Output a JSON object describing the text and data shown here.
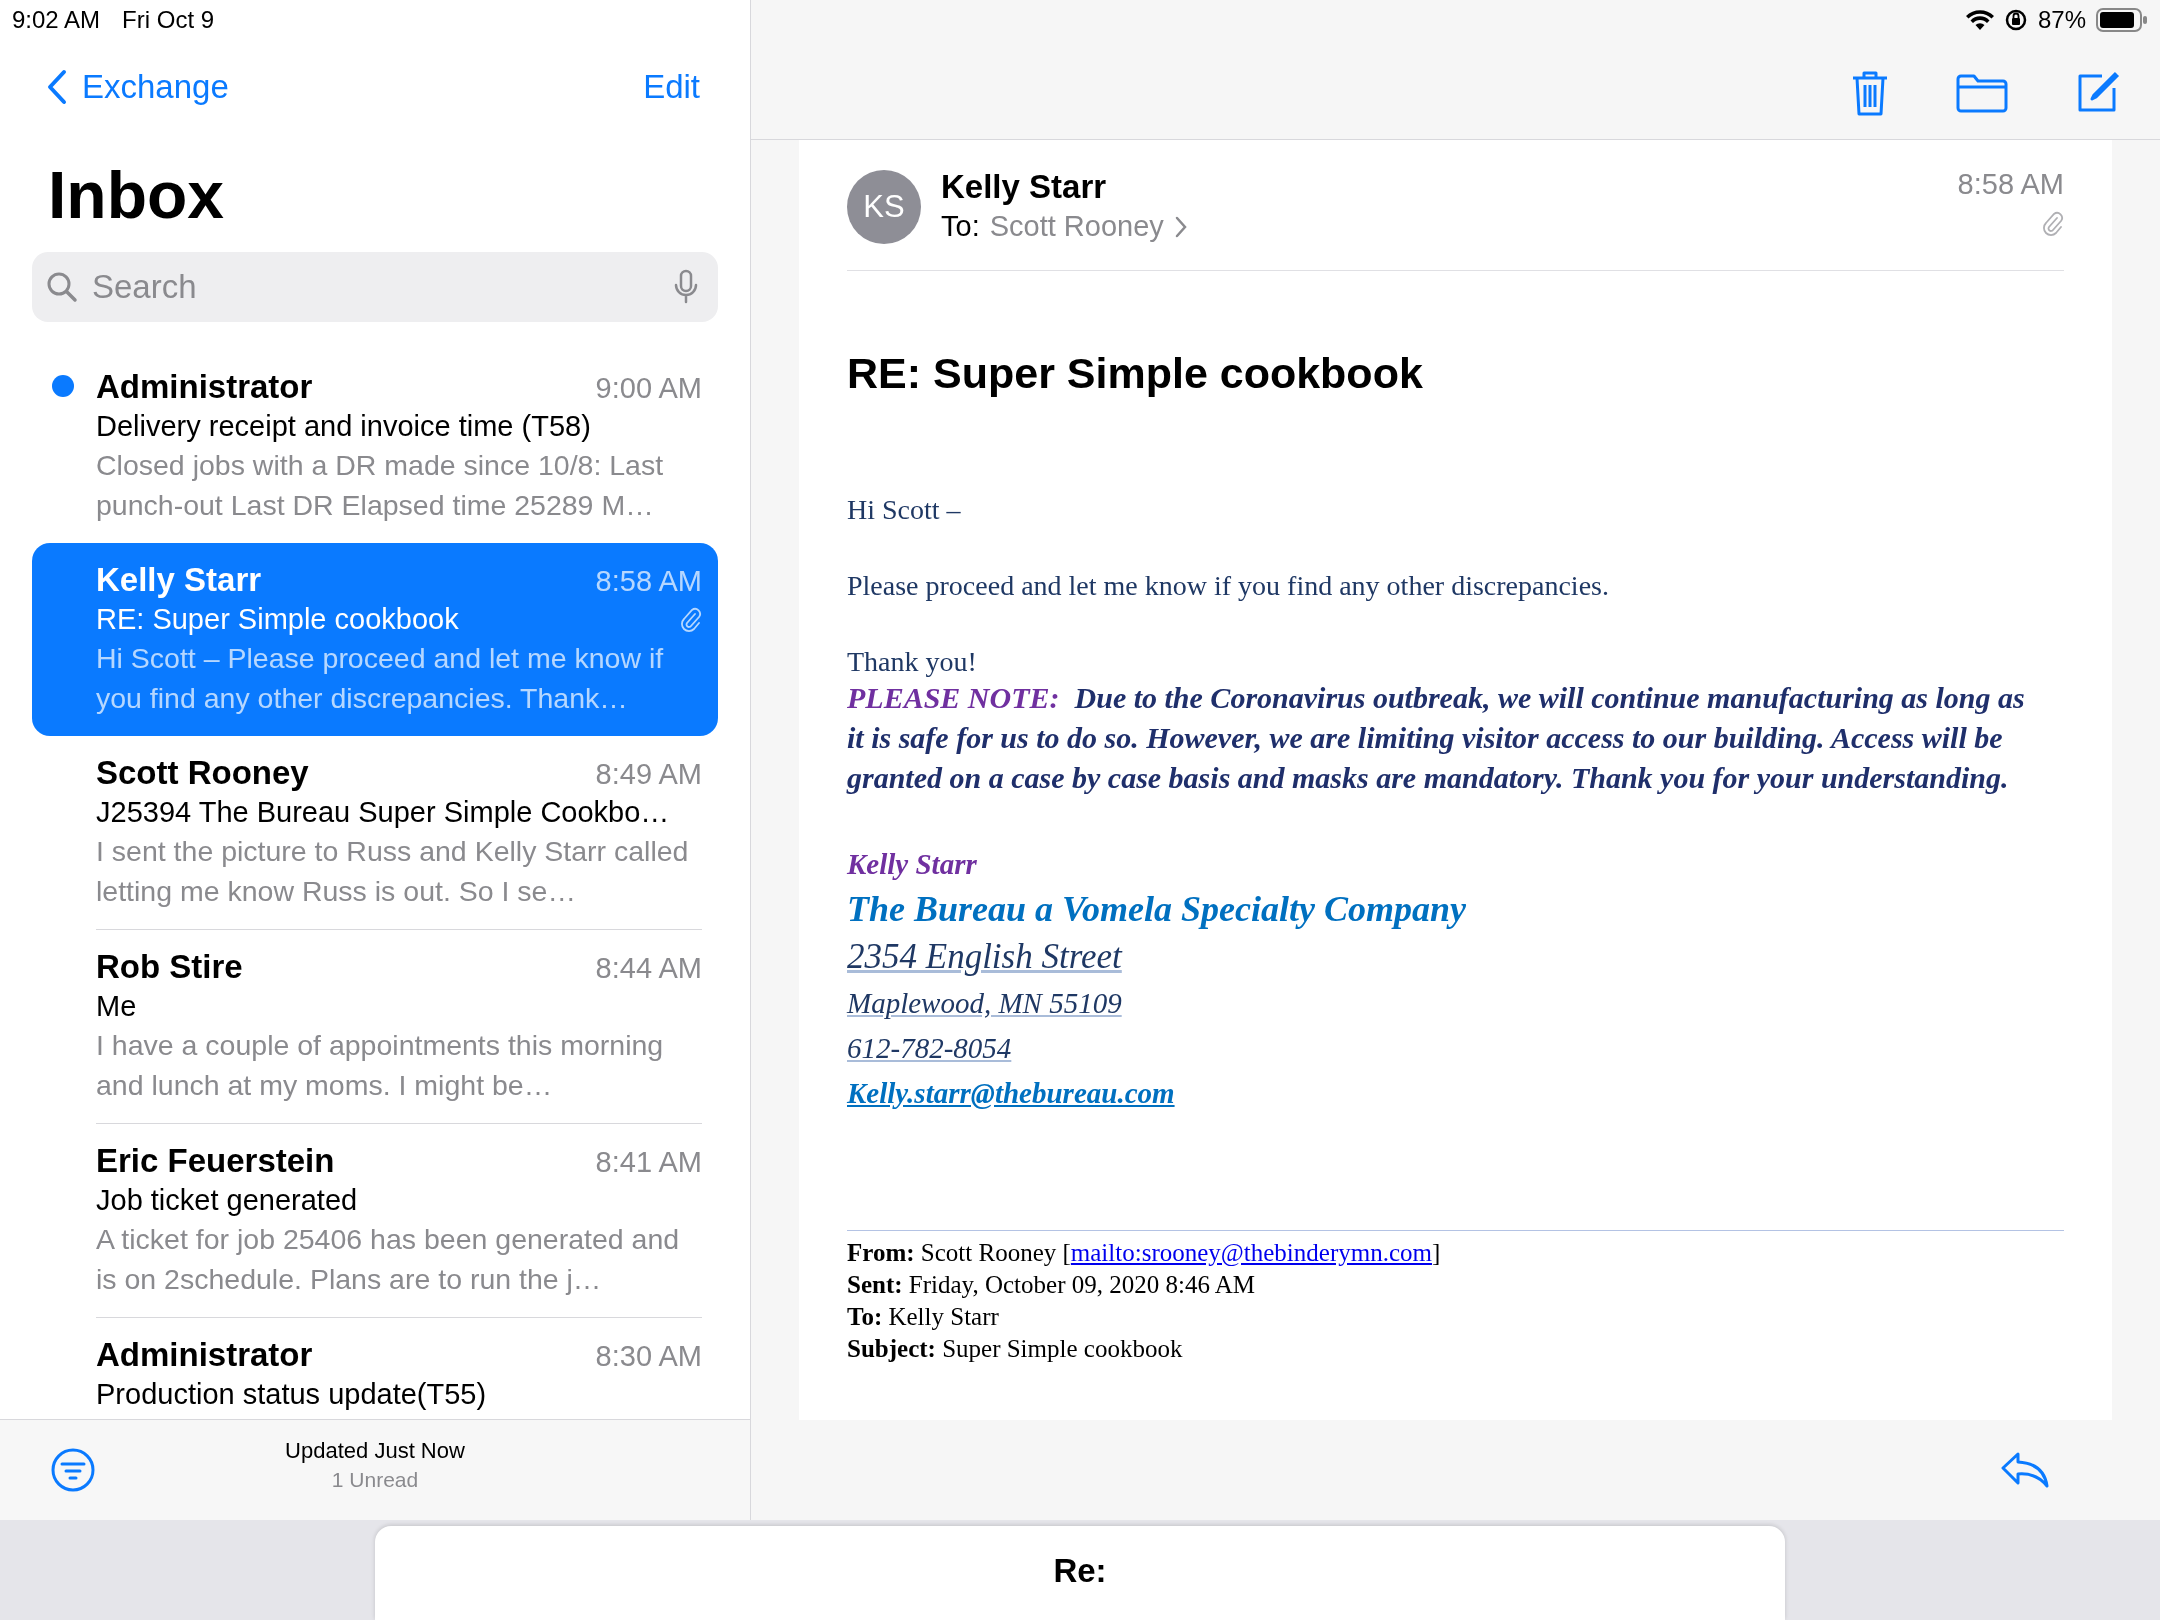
{
  "status_bar": {
    "time": "9:02 AM",
    "date": "Fri Oct 9",
    "battery_text": "87%"
  },
  "mailbox": {
    "back_label": "Exchange",
    "edit_label": "Edit",
    "title": "Inbox",
    "search": {
      "placeholder": "Search"
    },
    "messages": [
      {
        "sender": "Administrator",
        "time": "9:00 AM",
        "subject": "Delivery receipt and invoice time (T58)",
        "preview": "Closed jobs with a DR made since 10/8: Last punch-out Last DR Elapsed time 25289 M…",
        "unread": true,
        "selected": false,
        "attachment": false
      },
      {
        "sender": "Kelly Starr",
        "time": "8:58 AM",
        "subject": "RE: Super Simple cookbook",
        "preview": "Hi Scott – Please proceed and let me know if you find any other discrepancies. Thank…",
        "unread": false,
        "selected": true,
        "attachment": true
      },
      {
        "sender": "Scott Rooney",
        "time": "8:49 AM",
        "subject": "J25394 The Bureau Super Simple Cookbo…",
        "preview": "I sent the picture to Russ and Kelly Starr called letting me know Russ is out. So I se…",
        "unread": false,
        "selected": false,
        "attachment": false
      },
      {
        "sender": "Rob Stire",
        "time": "8:44 AM",
        "subject": "Me",
        "preview": "I have a couple of appointments this morning and lunch at my moms. I might be…",
        "unread": false,
        "selected": false,
        "attachment": false
      },
      {
        "sender": "Eric Feuerstein",
        "time": "8:41 AM",
        "subject": "Job ticket generated",
        "preview": "A ticket for job 25406 has been generated and is on 2schedule. Plans are to run the j…",
        "unread": false,
        "selected": false,
        "attachment": false
      },
      {
        "sender": "Administrator",
        "time": "8:30 AM",
        "subject": "Production status update(T55)",
        "unread": false,
        "selected": false,
        "attachment": false
      }
    ],
    "footer": {
      "updated": "Updated Just Now",
      "unread_count": "1 Unread"
    }
  },
  "message": {
    "avatar_initials": "KS",
    "sender": "Kelly Starr",
    "to_label": "To:",
    "to": "Scott Rooney",
    "time": "8:58 AM",
    "attachment": true,
    "subject": "RE: Super Simple cookbook",
    "body": {
      "greeting": "Hi Scott –",
      "paragraph": "Please proceed and let me know if you find any other discrepancies.",
      "closing": "Thank you!",
      "note": {
        "label": "PLEASE NOTE:",
        "text": "Due to the Coronavirus outbreak, we will continue manufacturing as long as it is safe for us to do so.  However, we are limiting visitor access to our building.  Access will be granted on a case by case basis and masks are mandatory.  Thank you for your understanding."
      },
      "signature": [
        {
          "kind": "name",
          "text": "Kelly Starr"
        },
        {
          "kind": "company",
          "text": "The Bureau a Vomela Specialty Company"
        },
        {
          "kind": "street",
          "text": "2354 English Street"
        },
        {
          "kind": "link",
          "text": "Maplewood, MN 55109"
        },
        {
          "kind": "link",
          "text": "612-782-8054"
        },
        {
          "kind": "email",
          "text": "Kelly.starr@thebureau.com"
        }
      ],
      "quoted_header": [
        {
          "label": "From:",
          "value": "Scott Rooney [",
          "link": "mailto:srooney@thebinderymn.com",
          "after": "]"
        },
        {
          "label": "Sent:",
          "value": "Friday, October 09, 2020 8:46 AM"
        },
        {
          "label": "To:",
          "value": "Kelly Starr"
        },
        {
          "label": "Subject:",
          "value": "Super Simple cookbook"
        }
      ]
    }
  },
  "compose": {
    "title": "Re:"
  }
}
